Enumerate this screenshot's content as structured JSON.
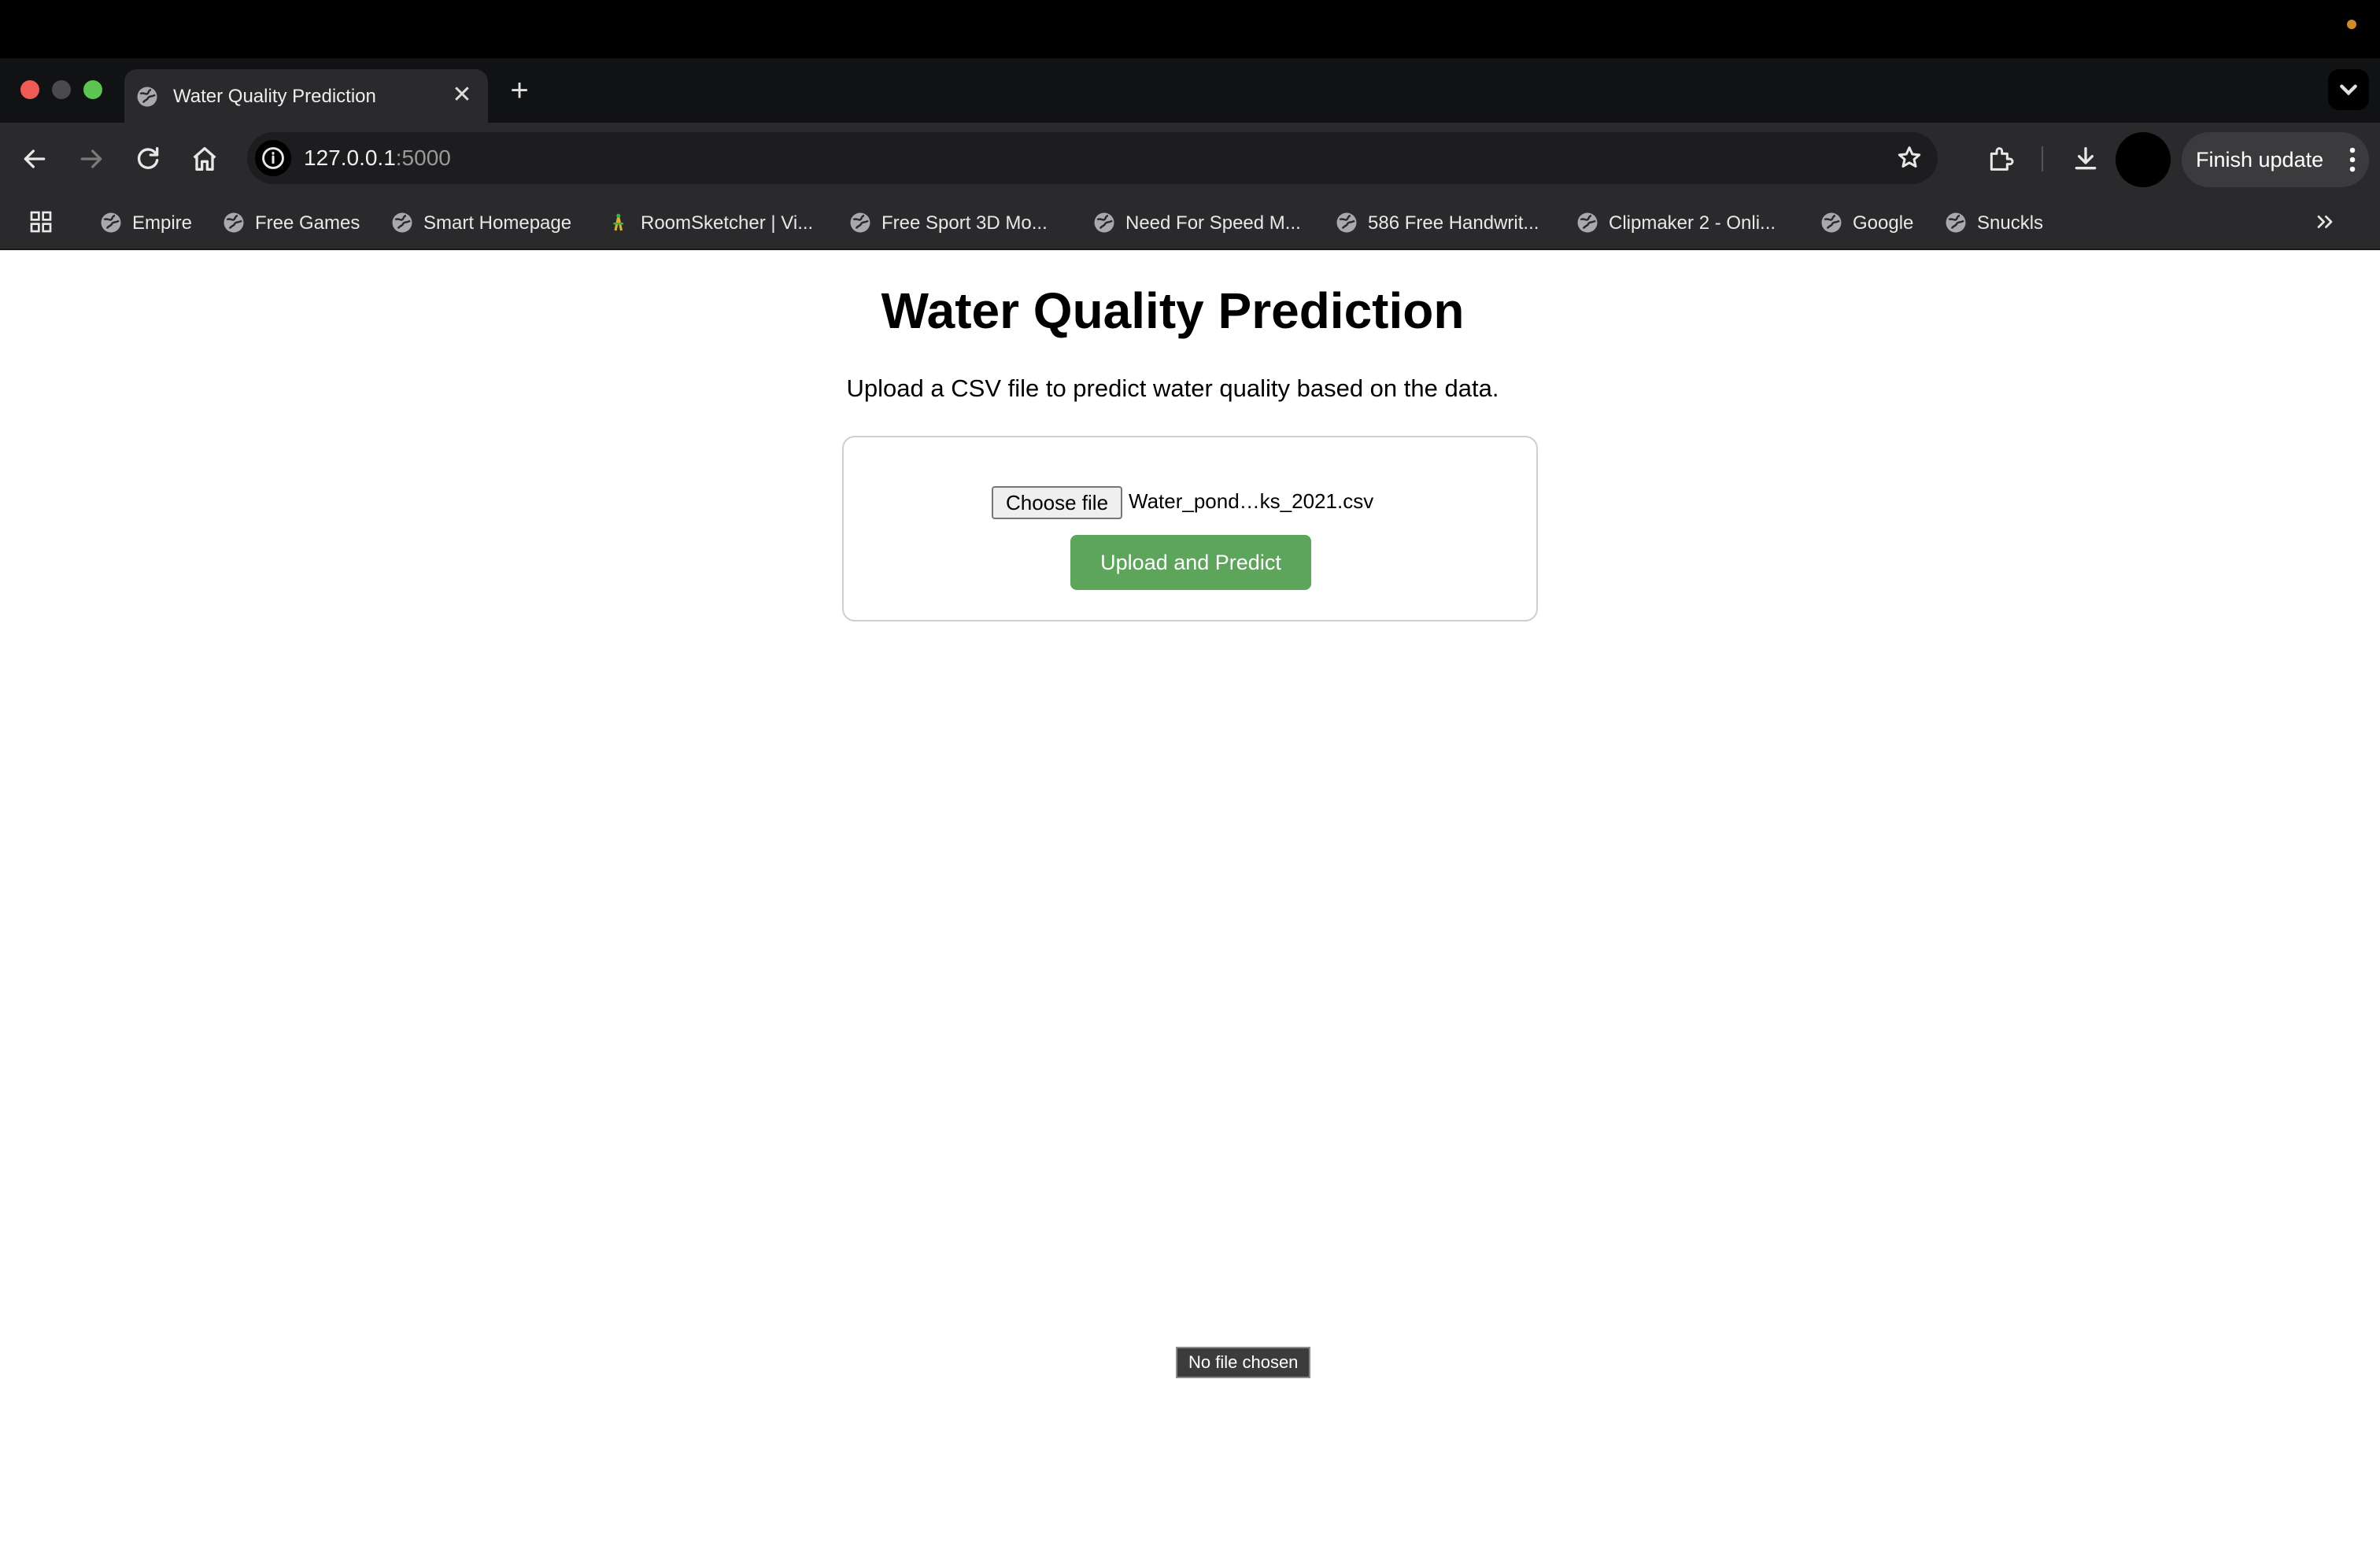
{
  "browser": {
    "tab": {
      "title": "Water Quality Prediction",
      "favicon": "globe-icon"
    },
    "url": {
      "host": "127.0.0.1",
      "port": ":5000"
    },
    "finish_update_label": "Finish update",
    "bookmarks": [
      {
        "label": "Empire",
        "icon": "globe-icon"
      },
      {
        "label": "Free Games",
        "icon": "globe-icon"
      },
      {
        "label": "Smart Homepage",
        "icon": "globe-icon"
      },
      {
        "label": "RoomSketcher | Vi...",
        "icon": "roomsketcher-icon"
      },
      {
        "label": "Free Sport 3D Mo...",
        "icon": "globe-icon"
      },
      {
        "label": "Need For Speed M...",
        "icon": "globe-icon"
      },
      {
        "label": "586 Free Handwrit...",
        "icon": "globe-icon"
      },
      {
        "label": "Clipmaker 2 - Onli...",
        "icon": "globe-icon"
      },
      {
        "label": "Google",
        "icon": "globe-icon"
      },
      {
        "label": "Snuckls",
        "icon": "globe-icon"
      }
    ]
  },
  "page": {
    "title": "Water Quality Prediction",
    "subtitle": "Upload a CSV file to predict water quality based on the data.",
    "file_input": {
      "button_label": "Choose file",
      "selected_file": "Water_pond…ks_2021.csv"
    },
    "submit_label": "Upload and Predict",
    "tooltip": "No file chosen"
  },
  "colors": {
    "accent_green": "#5ea55c",
    "chrome_dark": "#2a2a2d"
  }
}
